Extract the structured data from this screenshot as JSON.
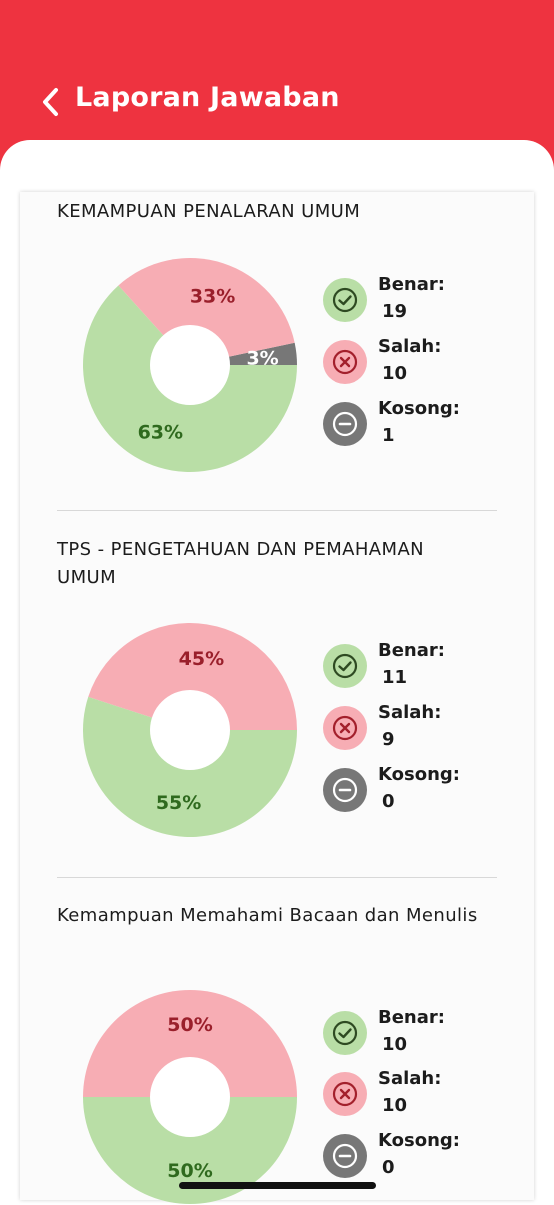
{
  "header": {
    "title": "Laporan Jawaban",
    "back_icon": "chevron-left-icon"
  },
  "colors": {
    "brand": "#ee3340",
    "correct": "#b9dea6",
    "correct_text": "#2f6a1e",
    "wrong": "#f7adb4",
    "wrong_text": "#9a1f2b",
    "empty": "#777777"
  },
  "legend_labels": {
    "correct": "Benar:",
    "wrong": "Salah:",
    "empty": "Kosong:"
  },
  "sections": [
    {
      "title": "KEMAMPUAN PENALARAN UMUM",
      "chart_data": {
        "type": "pie",
        "categories": [
          "Benar",
          "Salah",
          "Kosong"
        ],
        "values": [
          19,
          10,
          1
        ],
        "slice_labels": [
          "63%",
          "33%",
          "3%"
        ]
      },
      "benar": "19",
      "salah": "10",
      "kosong": "1"
    },
    {
      "title": "TPS - PENGETAHUAN DAN PEMAHAMAN UMUM",
      "chart_data": {
        "type": "pie",
        "categories": [
          "Benar",
          "Salah",
          "Kosong"
        ],
        "values": [
          11,
          9,
          0
        ],
        "slice_labels": [
          "55%",
          "45%",
          ""
        ]
      },
      "benar": "11",
      "salah": "9",
      "kosong": "0"
    },
    {
      "title": "Kemampuan Memahami Bacaan dan Menulis",
      "chart_data": {
        "type": "pie",
        "categories": [
          "Benar",
          "Salah",
          "Kosong"
        ],
        "values": [
          10,
          10,
          0
        ],
        "slice_labels": [
          "50%",
          "50%",
          ""
        ]
      },
      "benar": "10",
      "salah": "10",
      "kosong": "0"
    }
  ]
}
